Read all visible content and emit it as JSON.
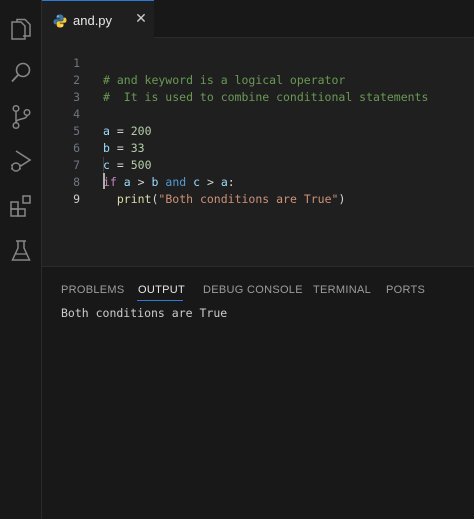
{
  "tab": {
    "file_name": "and.py",
    "close_glyph": "✕",
    "icon": "python-file-icon"
  },
  "activity_bar": {
    "icons": [
      "explorer-icon",
      "search-icon",
      "source-control-icon",
      "run-debug-icon",
      "extensions-icon",
      "testing-icon"
    ]
  },
  "editor": {
    "line_numbers": [
      "1",
      "2",
      "3",
      "4",
      "5",
      "6",
      "7",
      "8",
      "9"
    ],
    "lines": {
      "l1": "# and keyword is a logical operator",
      "l2": "#  It is used to combine conditional statements",
      "l4": {
        "var": "a",
        "op": " = ",
        "num": "200"
      },
      "l5": {
        "var": "b",
        "op": " = ",
        "num": "33"
      },
      "l6": {
        "var": "c",
        "op": " = ",
        "num": "500"
      },
      "l7": {
        "kw_if": "if",
        "v1": "a",
        "op1": " > ",
        "v2": "b",
        "kw_and": "and",
        "v3": "c",
        "op2": " > ",
        "v4": "a",
        "colon": ":"
      },
      "l8": {
        "func": "print",
        "open": "(",
        "str": "\"Both conditions are True\"",
        "close": ")"
      }
    },
    "active_line": 9
  },
  "panel": {
    "tabs": [
      "PROBLEMS",
      "OUTPUT",
      "DEBUG CONSOLE",
      "TERMINAL",
      "PORTS"
    ],
    "active_tab": "OUTPUT",
    "output": "Both conditions are True"
  },
  "colors": {
    "accent": "#2b7ad9",
    "background": "#1f1f1f",
    "comment": "#6a9955",
    "keyword": "#c586c0",
    "string": "#ce9178",
    "number": "#b5cea8",
    "variable": "#9cdcfe",
    "function": "#dcdcaa"
  }
}
